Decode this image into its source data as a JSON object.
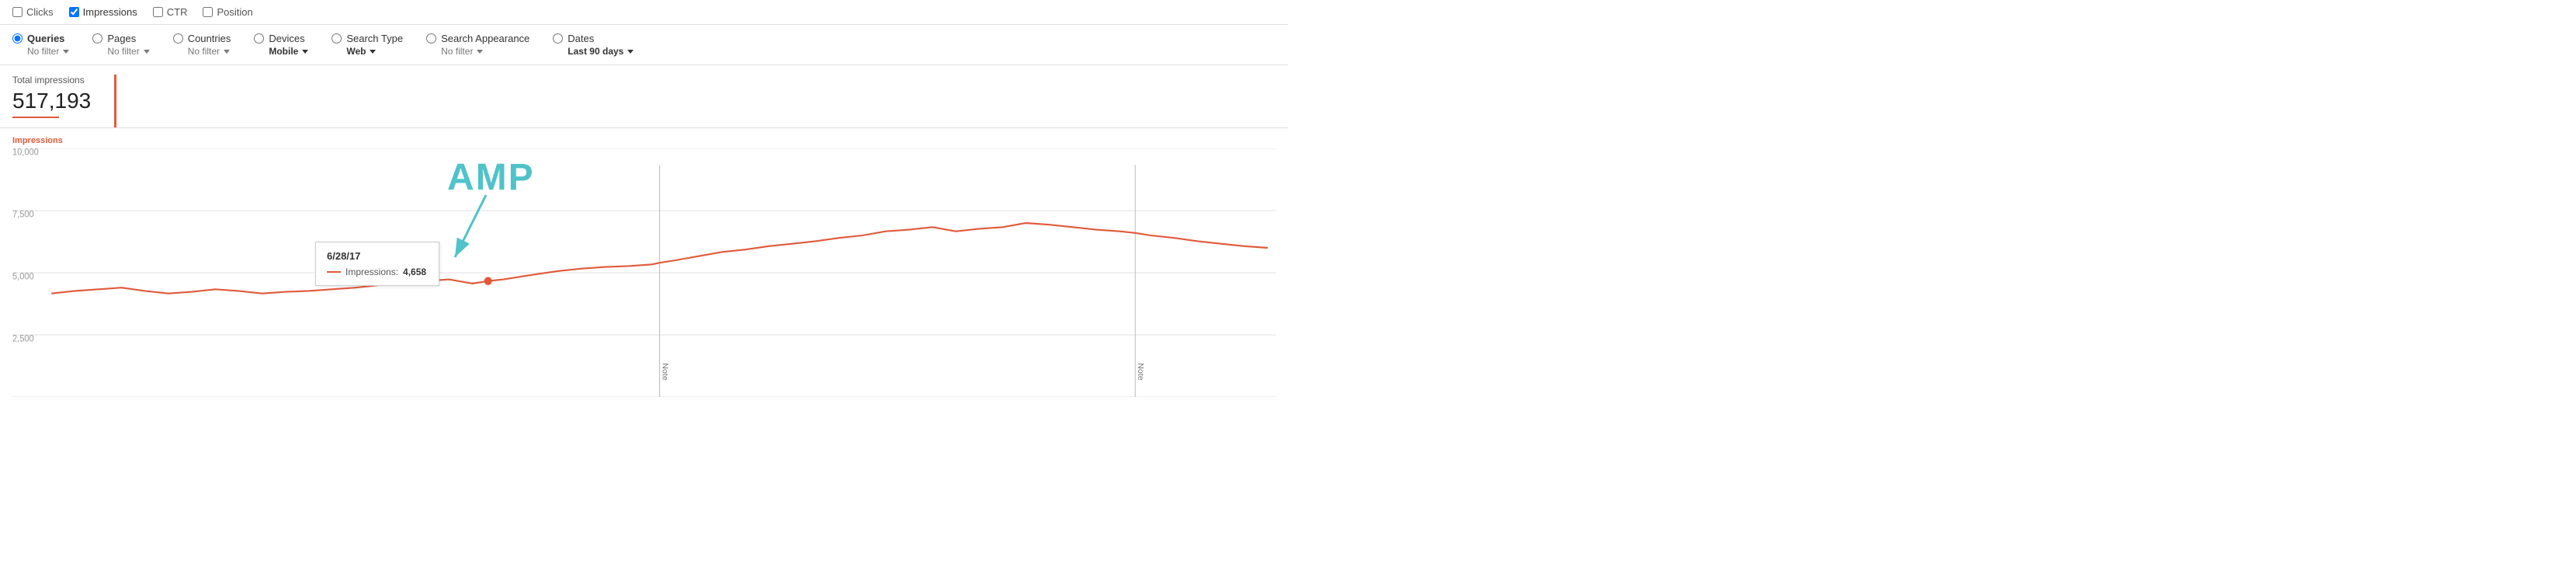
{
  "checkbox_bar": {
    "clicks": {
      "label": "Clicks",
      "checked": false
    },
    "impressions": {
      "label": "Impressions",
      "checked": true
    },
    "ctr": {
      "label": "CTR",
      "checked": false
    },
    "position": {
      "label": "Position",
      "checked": false
    }
  },
  "filters": [
    {
      "id": "queries",
      "label": "Queries",
      "value": "No filter",
      "selected": true,
      "value_bold": false
    },
    {
      "id": "pages",
      "label": "Pages",
      "value": "No filter",
      "selected": false,
      "value_bold": false
    },
    {
      "id": "countries",
      "label": "Countries",
      "value": "No filter",
      "selected": false,
      "value_bold": false
    },
    {
      "id": "devices",
      "label": "Devices",
      "value": "Mobile",
      "selected": false,
      "value_bold": true
    },
    {
      "id": "search-type",
      "label": "Search Type",
      "value": "Web",
      "selected": false,
      "value_bold": true
    },
    {
      "id": "search-appearance",
      "label": "Search Appearance",
      "value": "No filter",
      "selected": false,
      "value_bold": false
    },
    {
      "id": "dates",
      "label": "Dates",
      "value": "Last 90 days",
      "selected": false,
      "value_bold": true
    }
  ],
  "stats": {
    "label": "Total impressions",
    "value": "517,193"
  },
  "chart": {
    "y_label": "Impressions",
    "y_ticks": [
      "10,000",
      "7,500",
      "5,000",
      "2,500"
    ],
    "amp_label": "AMP",
    "note_label": "Note"
  },
  "tooltip": {
    "date": "6/28/17",
    "metric_label": "Impressions:",
    "metric_value": "4,658"
  }
}
